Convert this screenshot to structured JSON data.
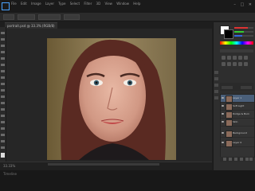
{
  "menubar": {
    "items": [
      "File",
      "Edit",
      "Image",
      "Layer",
      "Type",
      "Select",
      "Filter",
      "3D",
      "View",
      "Window",
      "Help"
    ]
  },
  "document": {
    "tab_title": "portrait.psd @ 33.3% (RGB/8)"
  },
  "status": {
    "zoom": "33.33%"
  },
  "layers": [
    {
      "name": "Layer 1"
    },
    {
      "name": "Soft Light"
    },
    {
      "name": "Dodge & Burn"
    },
    {
      "name": "Skin"
    },
    {
      "name": "Background"
    },
    {
      "name": "Layer 0"
    }
  ],
  "bottom": {
    "label": "Timeline"
  },
  "colors": {
    "accent": "#4aa3ff",
    "selected_layer": "#4a5f7a"
  }
}
